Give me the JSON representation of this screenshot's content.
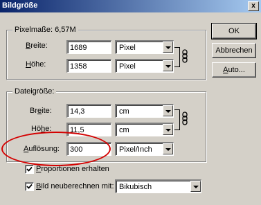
{
  "window": {
    "title": "Bildgröße",
    "close_label": "x"
  },
  "pixel_dimensions": {
    "legend": "Pixelmaße: 6,57M",
    "width_label_ul": "B",
    "width_label_rest": "reite:",
    "width_value": "1689",
    "width_unit": "Pixel",
    "height_label_ul": "H",
    "height_label_rest": "öhe:",
    "height_value": "1358",
    "height_unit": "Pixel"
  },
  "document_size": {
    "legend": "Dateigröße:",
    "width_label_pre": "Br",
    "width_label_ul": "e",
    "width_label_rest": "ite:",
    "width_value": "14,3",
    "width_unit": "cm",
    "height_label_pre": "Hö",
    "height_label_ul": "h",
    "height_label_rest": "e:",
    "height_value": "11,5",
    "height_unit": "cm",
    "resolution_label_ul": "A",
    "resolution_label_rest": "uflösung:",
    "resolution_value": "300",
    "resolution_unit": "Pixel/Inch"
  },
  "options": {
    "constrain_ul": "P",
    "constrain_rest": "roportionen erhalten",
    "constrain_checked": true,
    "resample_ul": "B",
    "resample_rest": "ild neuberechnen mit:",
    "resample_checked": true,
    "resample_method": "Bikubisch"
  },
  "buttons": {
    "ok": "OK",
    "cancel": "Abbrechen",
    "auto_ul": "A",
    "auto_rest": "uto..."
  },
  "annotation": {
    "color": "#d40000",
    "icon": "red-ellipse-highlight"
  },
  "colors": {
    "titlebar_start": "#0a246a",
    "titlebar_end": "#a6caf0",
    "dialog_bg": "#d4d0c8"
  }
}
